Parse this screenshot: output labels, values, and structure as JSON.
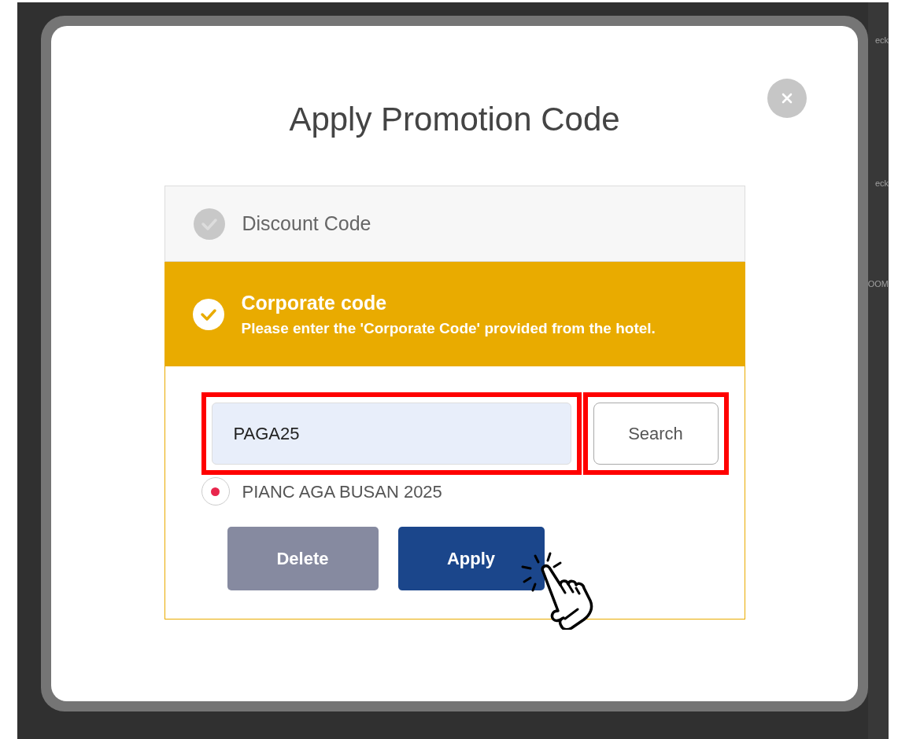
{
  "background_fragments": [
    "eck",
    "eck",
    "OOM"
  ],
  "dialog": {
    "title": "Apply Promotion Code",
    "options": [
      {
        "label": "Discount Code",
        "selected": false
      },
      {
        "label": "Corporate code",
        "description": "Please enter the 'Corporate Code' provided from the hotel.",
        "selected": true
      }
    ],
    "code_field": {
      "value": "PAGA25",
      "highlighted": true
    },
    "search_button": {
      "label": "Search",
      "highlighted": true
    },
    "results": [
      {
        "label": "PIANC AGA BUSAN 2025",
        "selected": true
      }
    ],
    "buttons": [
      {
        "kind": "secondary",
        "label": "Delete"
      },
      {
        "kind": "primary",
        "label": "Apply"
      }
    ]
  }
}
